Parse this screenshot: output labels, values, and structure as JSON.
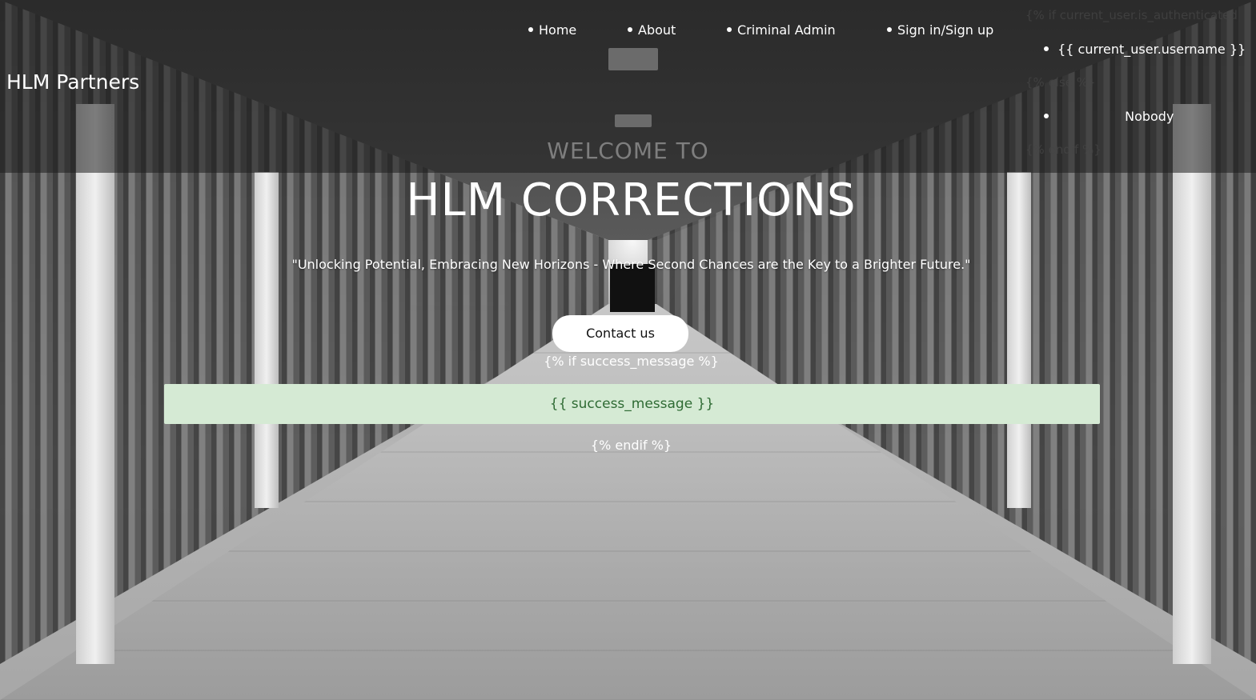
{
  "brand": "HLM Partners",
  "nav": {
    "items": [
      {
        "label": "Home"
      },
      {
        "label": "About"
      },
      {
        "label": "Criminal Admin"
      },
      {
        "label": "Sign in/Sign up"
      }
    ]
  },
  "user_block": {
    "if_line": "{% if current_user.is_authenticated",
    "username": "{{ current_user.username }}",
    "else_line": "{% else %}",
    "nobody": "Nobody",
    "endif_line": "{% endif %}"
  },
  "hero": {
    "welcome": "WELCOME TO",
    "title": "HLM CORRECTIONS",
    "tagline": "\"Unlocking Potential, Embracing New Horizons - Where Second Chances are the Key to a Brighter Future.\"",
    "contact_label": "Contact us",
    "if_success": "{% if success_message %}",
    "success_message": "{{ success_message }}",
    "endif": "{% endif %}"
  },
  "colors": {
    "success_bg": "#d5ead4",
    "success_text": "#2f6b34",
    "nav_text": "#ffffff"
  }
}
